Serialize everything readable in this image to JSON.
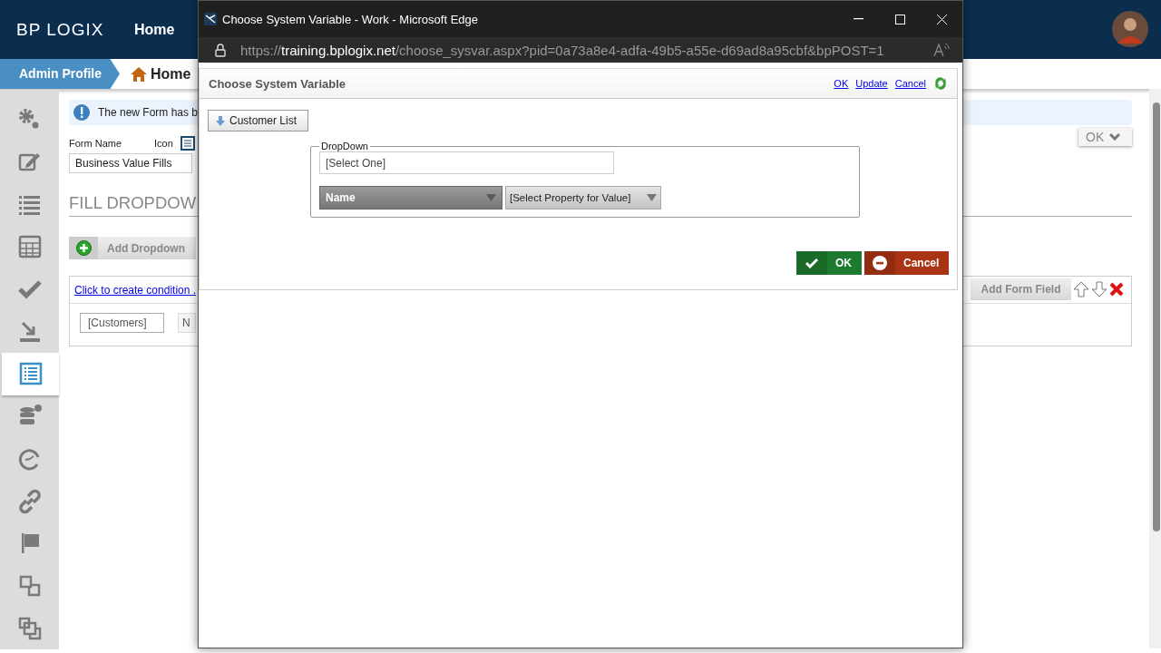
{
  "app": {
    "logo": "BP LOGIX",
    "nav": [
      {
        "label": "Home"
      }
    ],
    "breadcrumb": [
      {
        "label": "Admin Profile",
        "kind": "profile"
      },
      {
        "label": "Home",
        "kind": "home"
      }
    ],
    "sidebar": {
      "items": [
        {
          "selected": false
        },
        {
          "selected": false
        },
        {
          "selected": false
        },
        {
          "selected": false
        },
        {
          "selected": false
        },
        {
          "selected": false
        },
        {
          "selected": true
        },
        {
          "selected": false
        },
        {
          "selected": false
        },
        {
          "selected": false
        },
        {
          "selected": false
        },
        {
          "selected": false
        },
        {
          "selected": false
        }
      ]
    },
    "message": "The new Form has b",
    "form_name_label": "Form Name",
    "icon_label": "Icon",
    "form_name_value": "Business Value Fills",
    "ok_menu": "OK",
    "section_title": "FILL DROPDOW",
    "add_dropdown": "Add Dropdown",
    "condition_link": "Click to create condition .",
    "add_form_field": "Add Form Field",
    "row_fields": [
      "[Customers]",
      "N"
    ]
  },
  "popup": {
    "title": "Choose System Variable - Work - Microsoft Edge",
    "url_prefix": "https://",
    "url_host": "training.bplogix.net",
    "url_path": "/choose_sysvar.aspx?pid=0a73a8e4-adfa-49b5-a55e-d69ad8a95cbf&bpPOST=1",
    "heading": "Choose System Variable",
    "header_links": [
      "OK",
      "Update",
      "Cancel"
    ],
    "source_button": "Customer List",
    "fieldset_legend": "DropDown",
    "select_one": "[Select One]",
    "name_select": "Name",
    "property_select": "[Select Property for Value]",
    "ok": "OK",
    "cancel": "Cancel"
  }
}
